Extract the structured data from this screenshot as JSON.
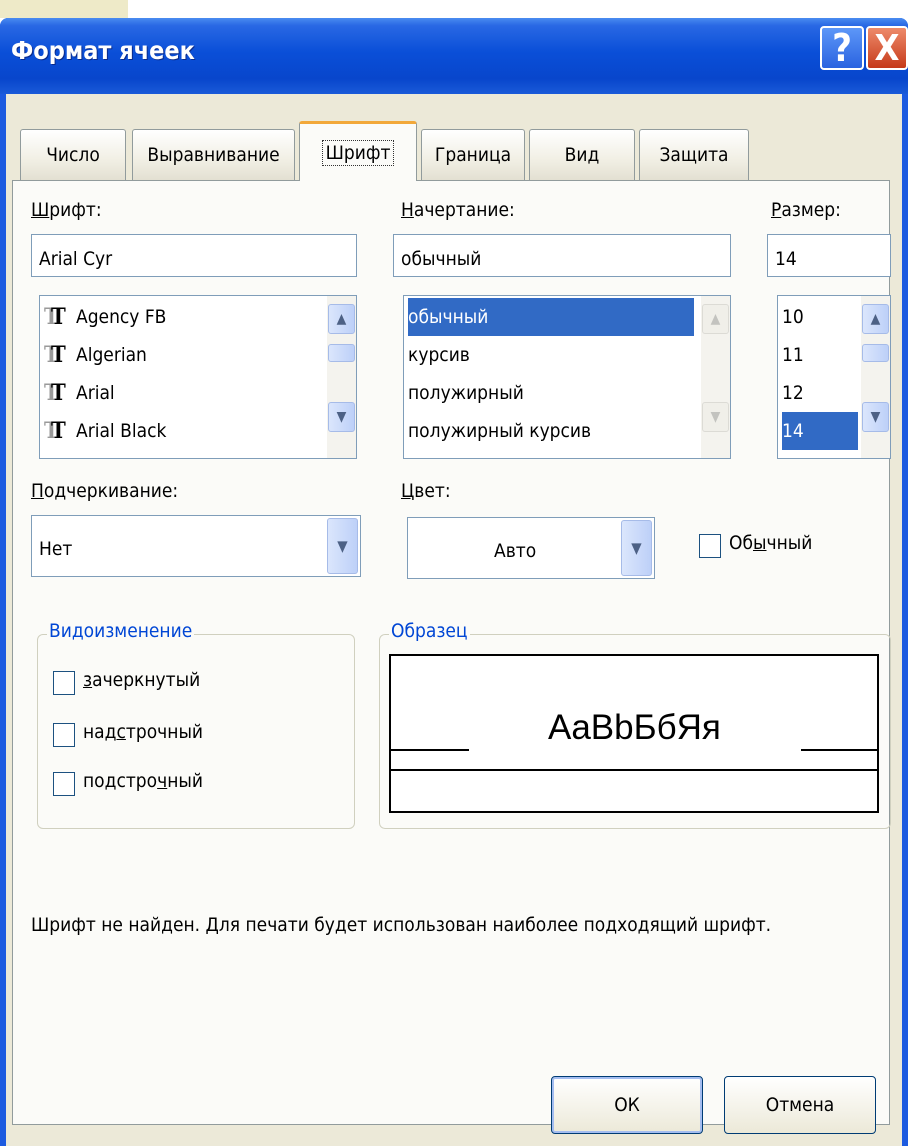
{
  "window": {
    "title": "Формат ячеек",
    "help_glyph": "?",
    "close_glyph": "X"
  },
  "tabs": [
    {
      "label": "Число",
      "active": false
    },
    {
      "label": "Выравнивание",
      "active": false
    },
    {
      "label": "Шрифт",
      "active": true
    },
    {
      "label": "Граница",
      "active": false
    },
    {
      "label": "Вид",
      "active": false
    },
    {
      "label": "Защита",
      "active": false
    }
  ],
  "font": {
    "label_hotkey": "Ш",
    "label_rest": "рифт:",
    "value": "Arial Cyr",
    "list": [
      "Agency FB",
      "Algerian",
      "Arial",
      "Arial Black"
    ],
    "font_icon_glyph": "TT"
  },
  "style": {
    "label_hotkey": "Н",
    "label_rest": "ачертание:",
    "value": "обычный",
    "list": [
      "обычный",
      "курсив",
      "полужирный",
      "полужирный курсив"
    ],
    "selected_index": 0
  },
  "size": {
    "label_hotkey": "Р",
    "label_rest": "азмер:",
    "value": "14",
    "list": [
      "10",
      "11",
      "12",
      "14"
    ],
    "selected_index": 3
  },
  "underline": {
    "label_hotkey": "П",
    "label_rest": "одчеркивание:",
    "value": "Нет"
  },
  "color": {
    "label_hotkey": "Ц",
    "label_rest": "вет:",
    "value": "Авто"
  },
  "normal_checkbox": {
    "label_a": "Об",
    "label_hotkey": "ы",
    "label_b": "чный",
    "checked": false
  },
  "effects": {
    "title": "Видоизменение",
    "items": [
      {
        "label_a": "",
        "hotkey": "з",
        "label_b": "ачеркнутый",
        "checked": false
      },
      {
        "label_a": "над",
        "hotkey": "с",
        "label_b": "трочный",
        "checked": false
      },
      {
        "label_a": "подстро",
        "hotkey": "ч",
        "label_b": "ный",
        "checked": false
      }
    ]
  },
  "sample": {
    "title": "Образец",
    "text": "AaBbБбЯя"
  },
  "note": "Шрифт не найден. Для печати будет использован наиболее подходящий шрифт.",
  "buttons": {
    "ok": "ОК",
    "cancel": "Отмена"
  },
  "icons": {
    "scroll_up": "▲",
    "scroll_down": "▼",
    "dropdown": "▼"
  },
  "colors": {
    "titlebar": "#0846cc",
    "selection": "#316ac5",
    "group_label": "#0046d5",
    "active_tab_accent": "#f2a83a"
  }
}
